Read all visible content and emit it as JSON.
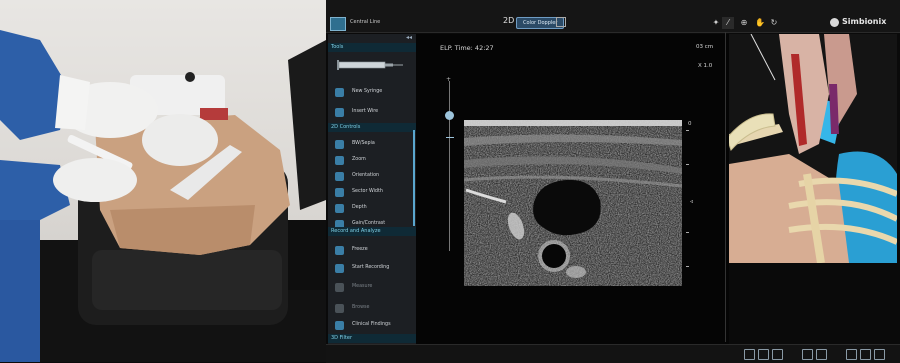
{
  "app": {
    "title": "Central Line",
    "mode_2d": "2D",
    "mode_doppler": "Color Doppler",
    "brand": "Simbionix"
  },
  "panel": {
    "tools_header": "Tools",
    "tools": [
      {
        "label": "New Syringe",
        "icon": "syringe-icon"
      },
      {
        "label": "Insert Wire",
        "icon": "wire-icon"
      }
    ],
    "controls_header": "2D Controls",
    "controls": [
      {
        "label": "BW/Sepia",
        "icon": "contrast-icon"
      },
      {
        "label": "Zoom",
        "icon": "zoom-icon"
      },
      {
        "label": "Orientation",
        "icon": "orientation-icon"
      },
      {
        "label": "Sector Width",
        "icon": "sector-icon"
      },
      {
        "label": "Depth",
        "icon": "depth-icon"
      },
      {
        "label": "Gain/Contrast",
        "icon": "gain-icon"
      }
    ],
    "record_header": "Record and Analyze",
    "record": [
      {
        "label": "Freeze",
        "icon": "freeze-icon",
        "enabled": true
      },
      {
        "label": "Start Recording",
        "icon": "record-icon",
        "enabled": true
      },
      {
        "label": "Measure",
        "icon": "measure-icon",
        "enabled": false
      },
      {
        "label": "Browse",
        "icon": "browse-icon",
        "enabled": false
      },
      {
        "label": "Clinical Findings",
        "icon": "findings-icon",
        "enabled": true
      }
    ],
    "filter_header": "3D Filter"
  },
  "ultrasound": {
    "elp_time": "ELP. Time: 42:27",
    "depth": "03 cm",
    "zoom": "X 1.0",
    "depth_zero": "0",
    "focus_marker": "◃"
  },
  "colors": {
    "accent": "#3a7ea6",
    "section_bg": "#0f2a36",
    "section_text": "#7ed0e6",
    "panel_bg": "#1c1f23"
  }
}
